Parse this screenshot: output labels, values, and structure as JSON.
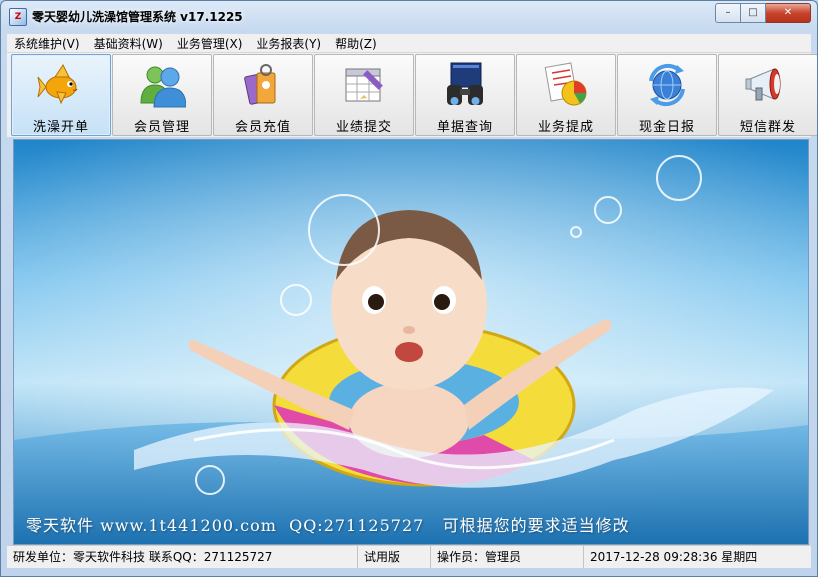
{
  "window": {
    "title": "零天婴幼儿洗澡馆管理系统  v17.1225",
    "icon_text": "Z",
    "controls": {
      "minimize": "–",
      "maximize": "□",
      "close": "✕"
    }
  },
  "menu": [
    {
      "label": "系统维护(V)"
    },
    {
      "label": "基础资料(W)"
    },
    {
      "label": "业务管理(X)"
    },
    {
      "label": "业务报表(Y)"
    },
    {
      "label": "帮助(Z)"
    }
  ],
  "toolbar": [
    {
      "label": "洗澡开单",
      "icon": "goldfish-icon",
      "active": true
    },
    {
      "label": "会员管理",
      "icon": "members-icon",
      "active": false
    },
    {
      "label": "会员充值",
      "icon": "card-recharge-icon",
      "active": false
    },
    {
      "label": "业绩提交",
      "icon": "calendar-pencil-icon",
      "active": false
    },
    {
      "label": "单据查询",
      "icon": "binoculars-icon",
      "active": false
    },
    {
      "label": "业务提成",
      "icon": "pie-chart-icon",
      "active": false
    },
    {
      "label": "现金日报",
      "icon": "refresh-globe-icon",
      "active": false
    },
    {
      "label": "短信群发",
      "icon": "megaphone-icon",
      "active": false
    }
  ],
  "banner": {
    "text": "零天软件 www.1t441200.com  QQ:271125727   可根据您的要求适当修改"
  },
  "status": {
    "developer": "研发单位：零天软件科技   联系QQ：271125727",
    "edition": "试用版",
    "operator": "操作员：管理员",
    "datetime": "2017-12-28 09:28:36 星期四"
  },
  "colors": {
    "window_frame": "#b9d1ea",
    "active_button": "#c6e1f6",
    "water": "#3a9ad6"
  }
}
